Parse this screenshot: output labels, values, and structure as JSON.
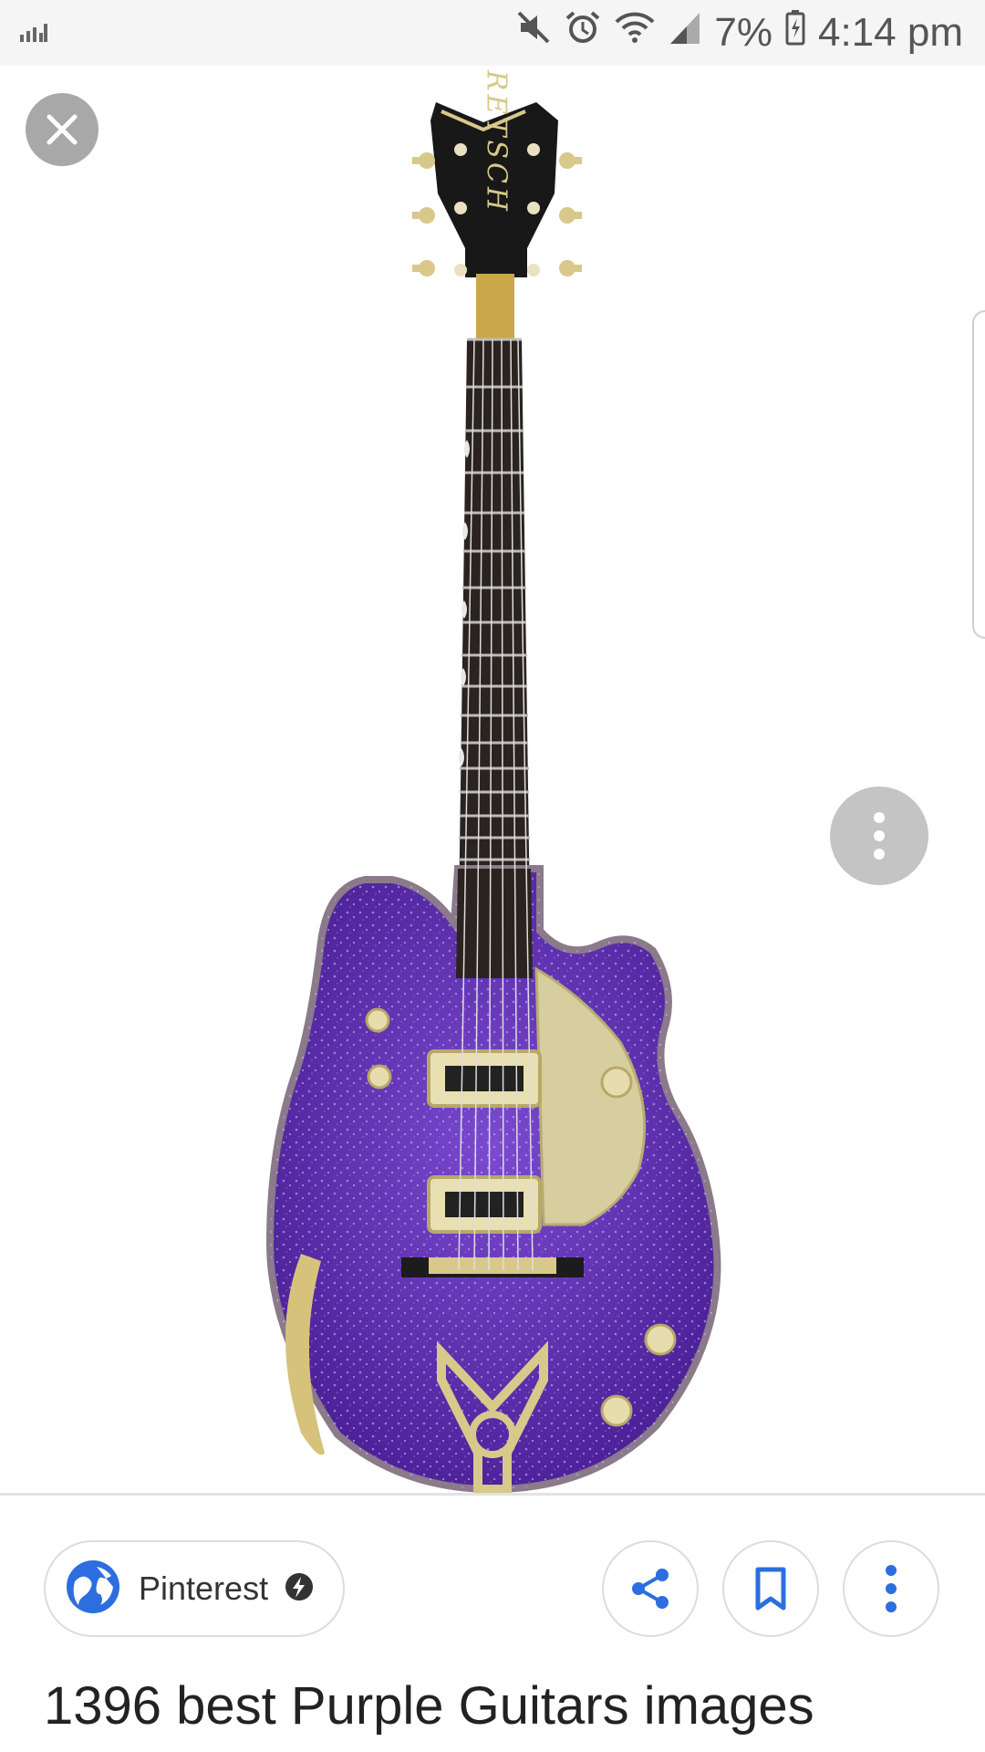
{
  "status_bar": {
    "battery_percent": "7%",
    "time": "4:14 pm",
    "icons": [
      "signal-bars-icon",
      "mute-icon",
      "alarm-icon",
      "wifi-icon",
      "cell-signal-icon",
      "battery-charging-icon"
    ]
  },
  "image_viewer": {
    "image_subject": "purple sparkle Gretsch electric guitar",
    "headstock_text": "GRETSCH",
    "colors": {
      "body": "#5b2fa8",
      "hardware": "#d8c88a",
      "fretboard": "#2a2320"
    }
  },
  "source": {
    "label": "Pinterest",
    "badge_icon": "lightning-bolt-icon"
  },
  "actions": {
    "share_icon": "share-icon",
    "save_icon": "bookmark-icon",
    "more_icon": "more-vert-icon"
  },
  "result": {
    "title": "1396 best Purple Guitars images"
  }
}
